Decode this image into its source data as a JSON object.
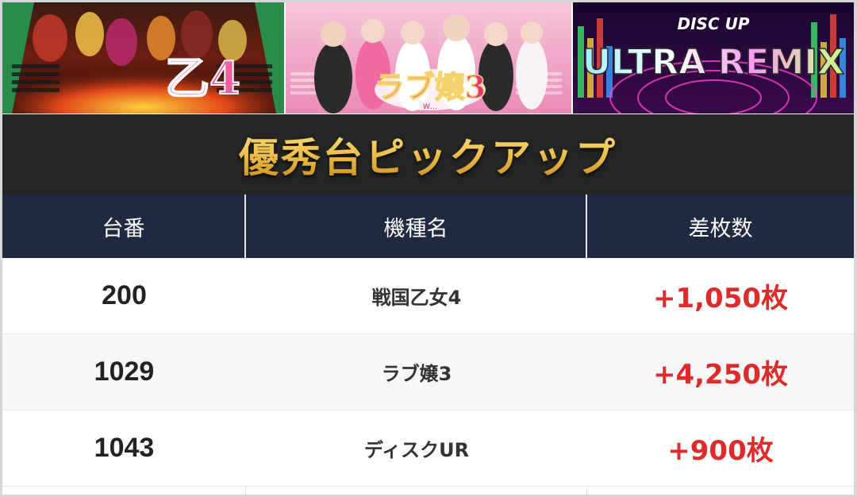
{
  "banners": [
    {
      "name": "sengoku-otome-4-banner",
      "logo_text": "乙4"
    },
    {
      "name": "love-jou-3-banner",
      "logo_text": "ラブ嬢3",
      "sub_text": "W…"
    },
    {
      "name": "disc-up-ultra-remix-banner",
      "top_text": "DISC UP",
      "main_text": "ULTRA REMIX"
    }
  ],
  "title": "優秀台ピックアップ",
  "colors": {
    "title_gold": "#f0c24f",
    "header_bg": "#1f2940",
    "diff_red": "#dd2a2a",
    "title_bg": "#252525"
  },
  "table": {
    "headers": [
      "台番",
      "機種名",
      "差枚数"
    ],
    "rows": [
      {
        "number": "200",
        "machine": "戦国乙女4",
        "diff": "+1,050枚"
      },
      {
        "number": "1029",
        "machine": "ラブ嬢3",
        "diff": "+4,250枚"
      },
      {
        "number": "1043",
        "machine": "ディスクUR",
        "diff": "+900枚"
      }
    ]
  }
}
